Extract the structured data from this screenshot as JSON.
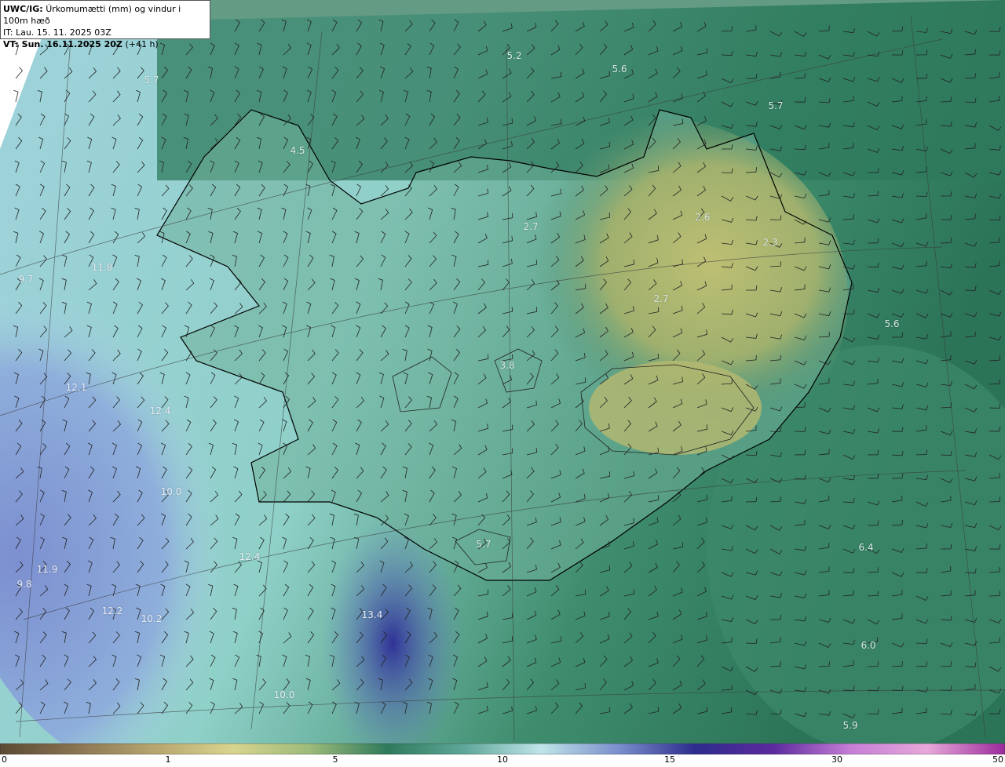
{
  "header": {
    "model": "UWC/IG:",
    "product": "Úrkomumætti (mm) og vindur i 100m hæð",
    "init_time": "IT: Lau. 15. 11. 2025 03Z",
    "valid_time": "VT: Sun. 16.11.2025 20Z",
    "lead_time": "(+41 h)"
  },
  "map_values": [
    {
      "id": "v1",
      "text": "5.2"
    },
    {
      "id": "v2",
      "text": "5.6"
    },
    {
      "id": "v3",
      "text": "5.7"
    },
    {
      "id": "v4",
      "text": "5.7"
    },
    {
      "id": "v5",
      "text": "4.5"
    },
    {
      "id": "v6",
      "text": "2.7"
    },
    {
      "id": "v7",
      "text": "2.6"
    },
    {
      "id": "v8",
      "text": "2.3"
    },
    {
      "id": "v9",
      "text": "2.7"
    },
    {
      "id": "v10",
      "text": "11.8"
    },
    {
      "id": "v11",
      "text": "9.7"
    },
    {
      "id": "v12",
      "text": "5.6"
    },
    {
      "id": "v13",
      "text": "3.8"
    },
    {
      "id": "v14",
      "text": "12.1"
    },
    {
      "id": "v15",
      "text": "12.4"
    },
    {
      "id": "v16",
      "text": "10.0"
    },
    {
      "id": "v17",
      "text": "12.4"
    },
    {
      "id": "v18",
      "text": "5.7"
    },
    {
      "id": "v19",
      "text": "6.4"
    },
    {
      "id": "v20",
      "text": "11.9"
    },
    {
      "id": "v21",
      "text": "9.8"
    },
    {
      "id": "v22",
      "text": "12.2"
    },
    {
      "id": "v23",
      "text": "10.2"
    },
    {
      "id": "v24",
      "text": "13.4"
    },
    {
      "id": "v25",
      "text": "6.0"
    },
    {
      "id": "v26",
      "text": "10.0"
    },
    {
      "id": "v27",
      "text": "5.9"
    }
  ],
  "colorbar": {
    "ticks": [
      "0",
      "1",
      "5",
      "10",
      "15",
      "30",
      "50"
    ],
    "colors": [
      "#5b4a33",
      "#8a7552",
      "#b7a66f",
      "#d8d48e",
      "#9dbb7a",
      "#2f7a5c",
      "#5fa79a",
      "#bfe5e8",
      "#7b8fcd",
      "#2d2c8c",
      "#5c2a9e",
      "#c67ed6",
      "#e7a8d9",
      "#9b2a9c"
    ]
  },
  "colors": {
    "ocean_north": "#2f7a5c",
    "land_high": "#b9bd72",
    "ocean_west": "#7f95cf",
    "precip_core": "#3a3c9e",
    "coastline": "#000000"
  }
}
